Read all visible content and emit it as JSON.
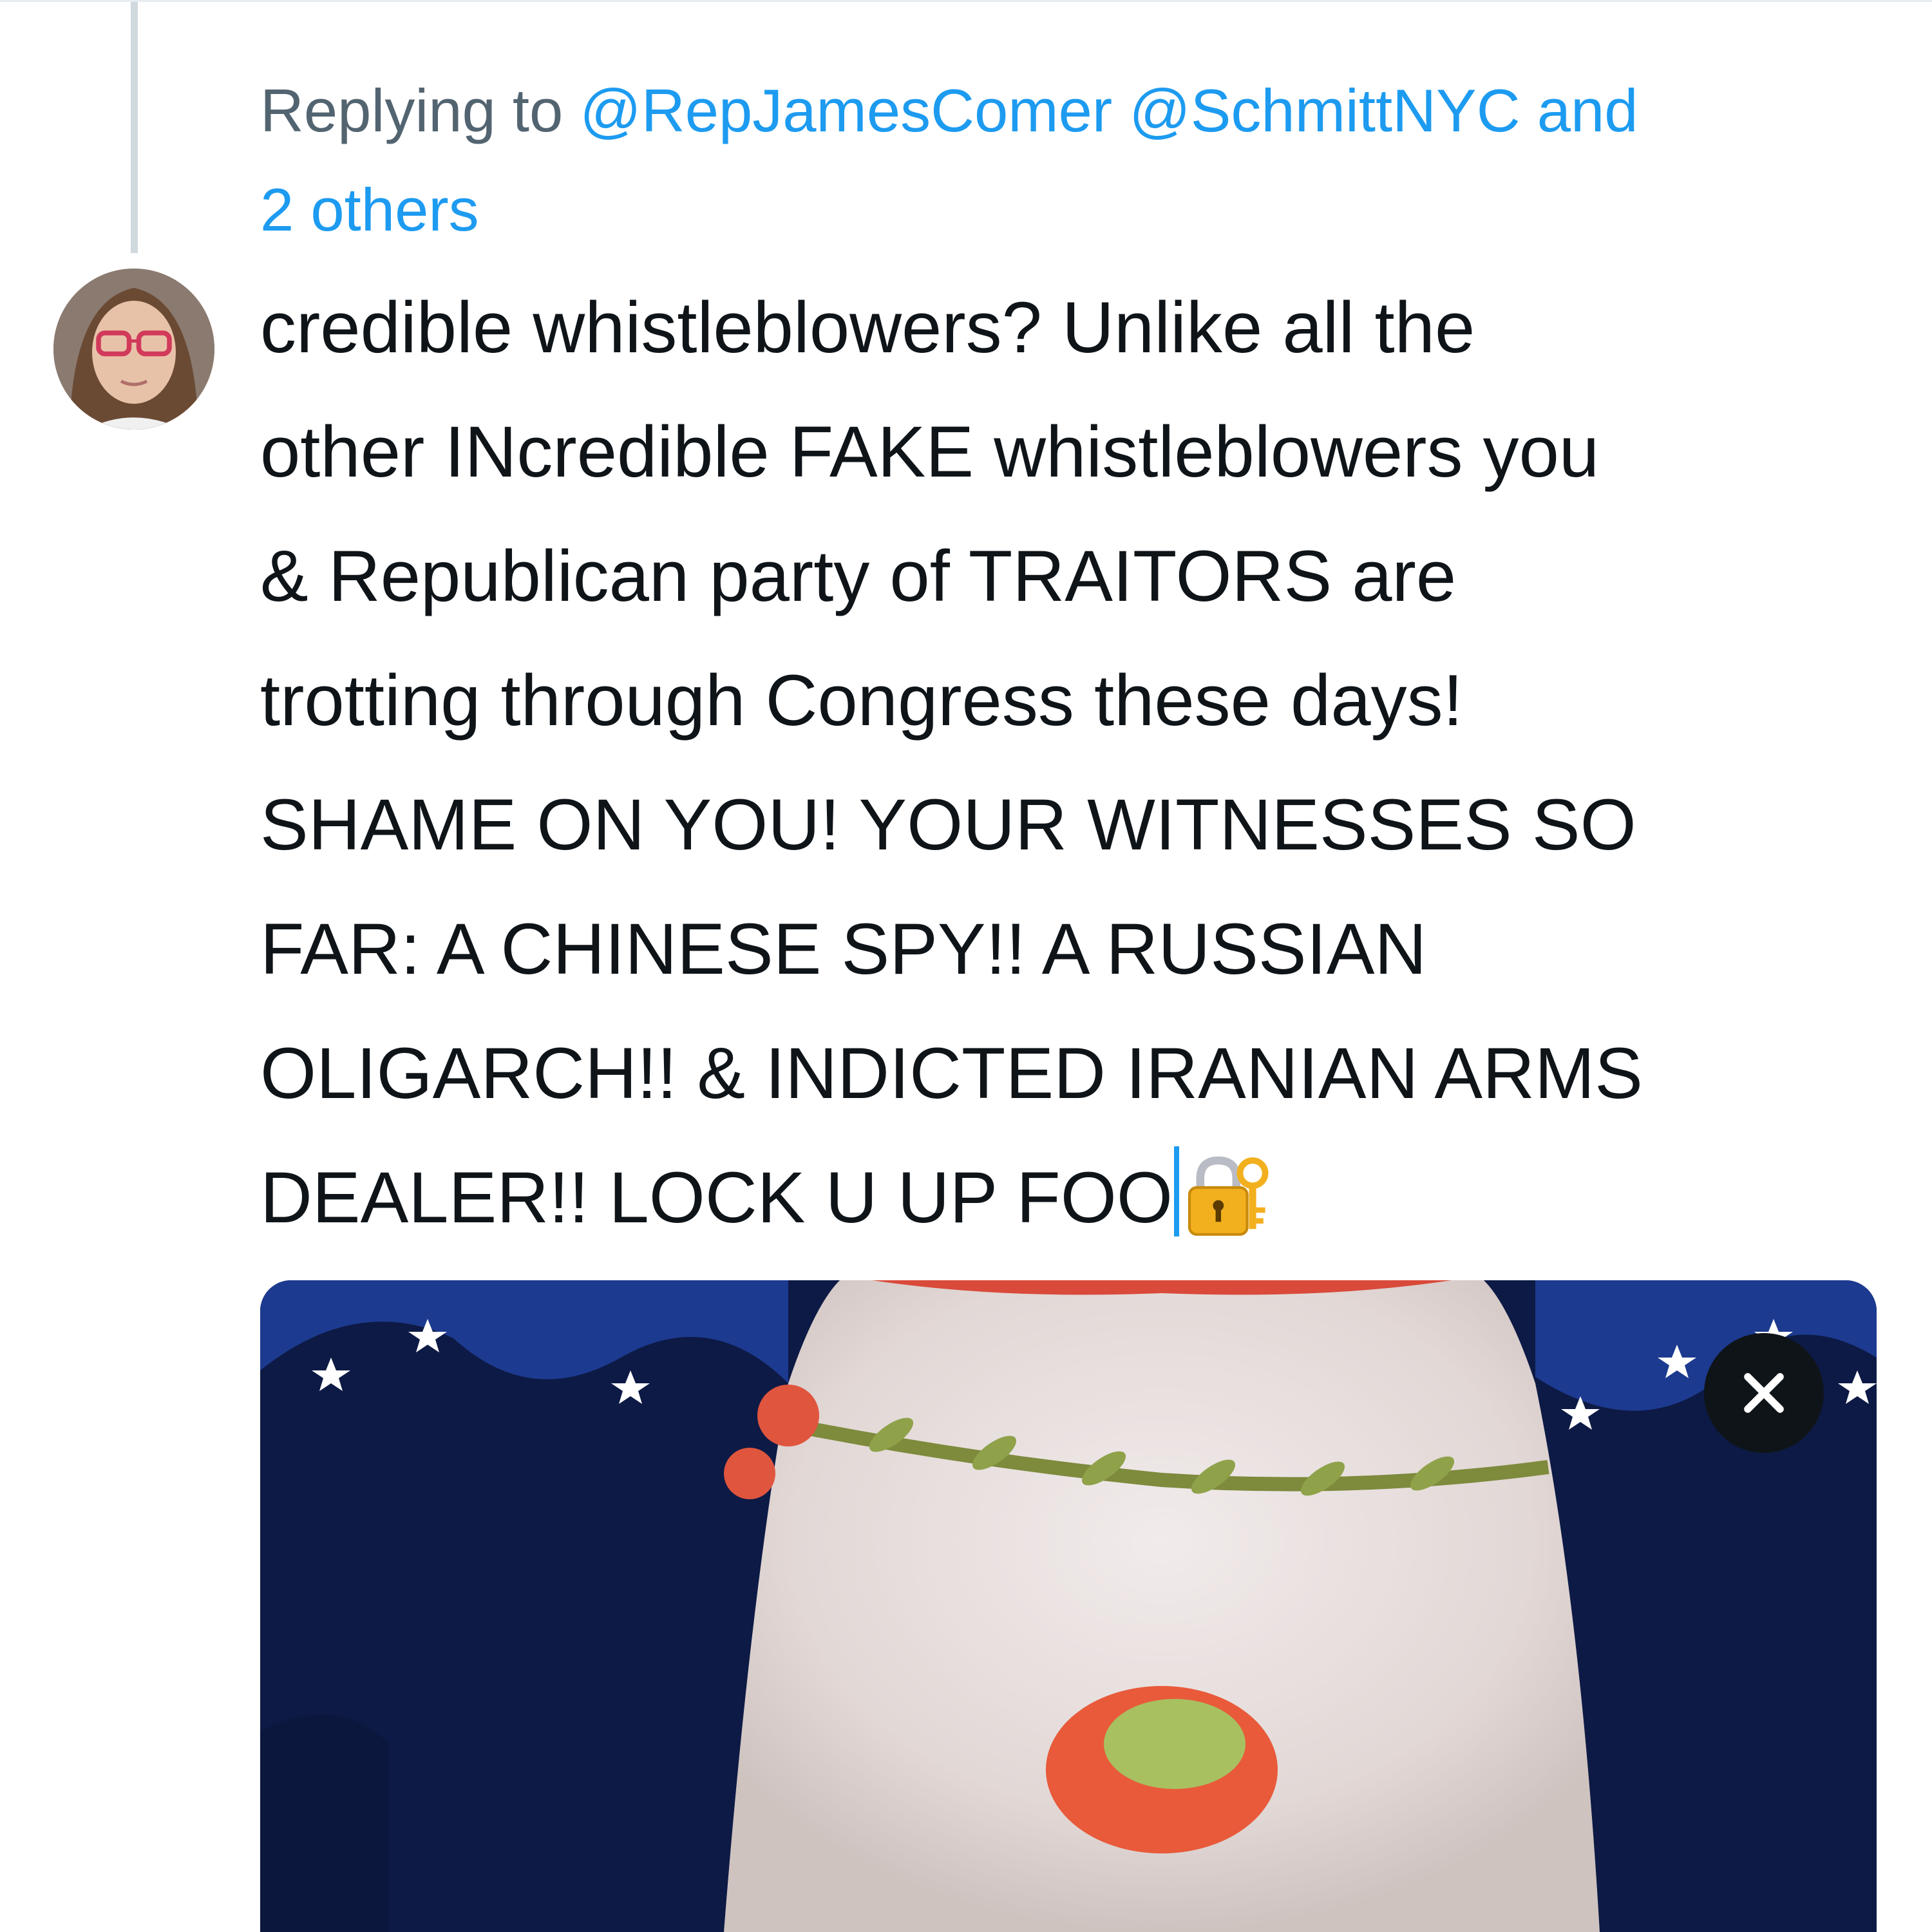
{
  "reply_context": {
    "prefix": "Replying to ",
    "mention_1": "@RepJamesComer",
    "mention_2": "@SchmittNYC",
    "suffix": " and",
    "others": "2 others"
  },
  "tweet": {
    "lines": [
      "credible whistleblowers? Unlike all the",
      "other INcredible FAKE whistleblowers you",
      "& Republican party of TRAITORS are",
      "trotting through Congress these days!",
      "SHAME ON YOU! YOUR WITNESSES SO",
      "FAR: A CHINESE SPY!! A RUSSIAN",
      "OLIGARCH!! & INDICTED IRANIAN ARMS",
      "DEALER!! LOCK U UP FOO"
    ],
    "emoji": "closed-lock-with-key-icon"
  },
  "media": {
    "type": "gif-attachment",
    "remove_icon": "close-icon"
  },
  "colors": {
    "link": "#1d9bf0",
    "secondary_text": "#536471",
    "primary_text": "#0f1419",
    "thread_line": "#cfd9de"
  }
}
